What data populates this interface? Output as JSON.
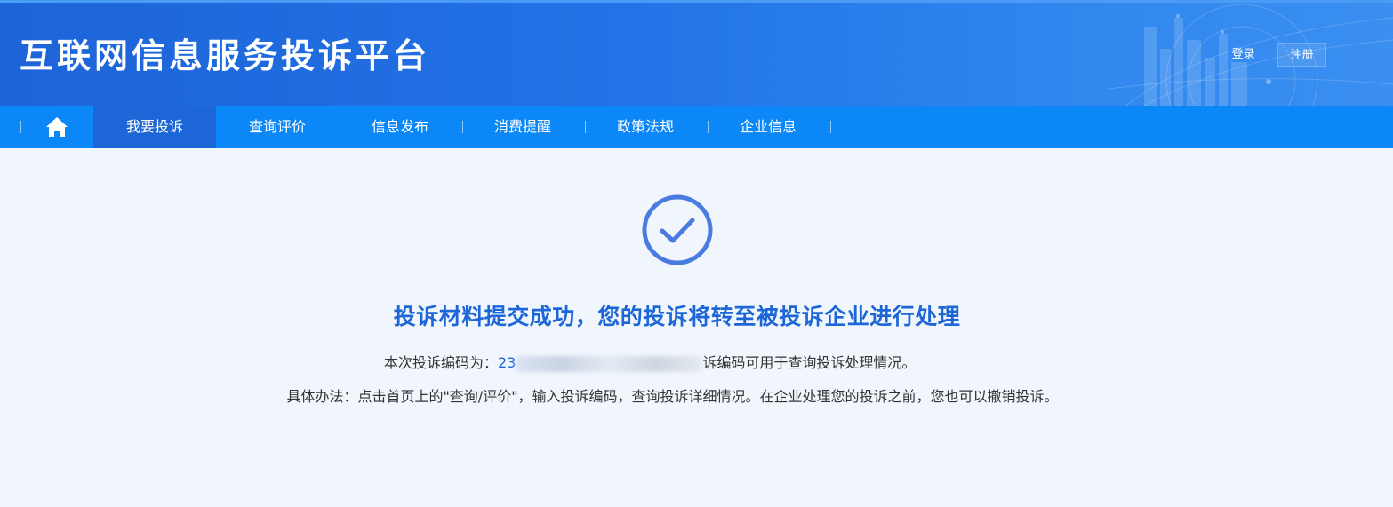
{
  "header": {
    "title": "互联网信息服务投诉平台",
    "login_label": "登录",
    "register_label": "注册"
  },
  "nav": {
    "home_icon": "home-icon",
    "items": [
      {
        "label": "我要投诉",
        "active": true
      },
      {
        "label": "查询评价",
        "active": false
      },
      {
        "label": "信息发布",
        "active": false
      },
      {
        "label": "消费提醒",
        "active": false
      },
      {
        "label": "政策法规",
        "active": false
      },
      {
        "label": "企业信息",
        "active": false
      }
    ]
  },
  "result": {
    "icon": "check-circle-icon",
    "title": "投诉材料提交成功，您的投诉将转至被投诉企业进行处理",
    "code_prefix": "本次投诉编码为：",
    "code_value": "23",
    "code_suffix": "诉编码可用于查询投诉处理情况。",
    "method_text": "具体办法：点击首页上的\"查询/评价\"，输入投诉编码，查询投诉详细情况。在企业处理您的投诉之前，您也可以撤销投诉。"
  },
  "colors": {
    "brand_blue": "#1c66d8",
    "nav_blue": "#0b87f7",
    "page_bg": "#f1f6fc",
    "check_color": "#4a7be0"
  }
}
